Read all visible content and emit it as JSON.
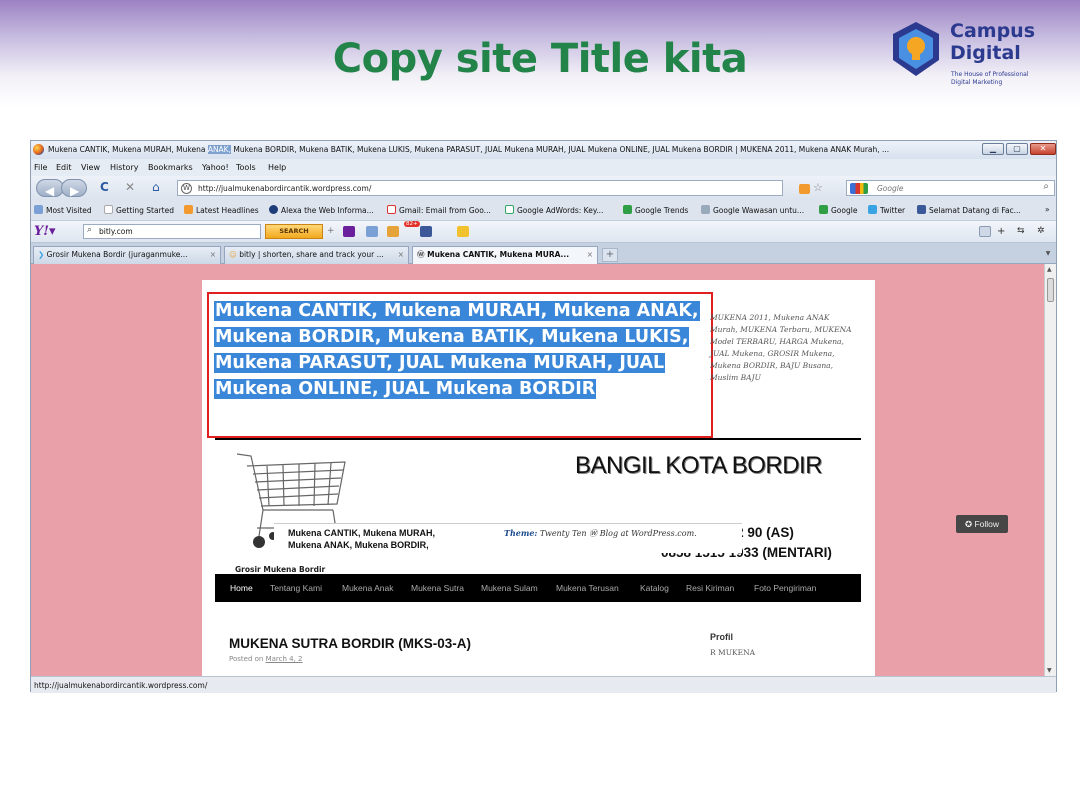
{
  "slide": {
    "title": "Copy site Title kita",
    "logo": {
      "line1": "Campus",
      "line2": "Digital",
      "tagline1": "The House of Professional",
      "tagline2": "Digital Marketing",
      "icon": "lightbulb-shield-icon",
      "brand_color": "#2b3a8f",
      "accent_color": "#f5a623"
    }
  },
  "browser": {
    "window_title": "Mukena CANTIK, Mukena MURAH, Mukena ANAK, Mukena BORDIR, Mukena BATIK, Mukena LUKIS, Mukena PARASUT, JUAL Mukena MURAH, JUAL Mukena ONLINE, JUAL Mukena BORDIR | MUKENA 2011, Mukena ANAK Murah, ...",
    "window_title_pre": "Mukena CANTIK, Mukena MURAH, Mukena ",
    "window_title_hl": "ANAK,",
    "window_title_post": " Mukena BORDIR, Mukena BATIK, Mukena LUKIS, Mukena PARASUT, JUAL Mukena MURAH, JUAL Mukena ONLINE, JUAL Mukena BORDIR | MUKENA 2011, Mukena ANAK Murah, ...",
    "menu": [
      "File",
      "Edit",
      "View",
      "History",
      "Bookmarks",
      "Yahoo!",
      "Tools",
      "Help"
    ],
    "url": "http://jualmukenabordircantik.wordpress.com/",
    "search_placeholder": "Google",
    "bookmarks": [
      "Most Visited",
      "Getting Started",
      "Latest Headlines",
      "Alexa the Web Informa...",
      "Gmail: Email from Goo...",
      "Google AdWords: Key...",
      "Google Trends",
      "Google Wawasan untu...",
      "Google",
      "Twitter",
      "Selamat Datang di Fac..."
    ],
    "yahoo_search_value": "bitly.com",
    "yahoo_search_button": "SEARCH",
    "mail_badge": "82+",
    "tabs": [
      {
        "label": "Grosir Mukena Bordir (juraganmuke...",
        "active": false
      },
      {
        "label": "bitly | shorten, share and track your ...",
        "active": false
      },
      {
        "label": "Mukena CANTIK, Mukena MURA...",
        "active": true
      }
    ],
    "status_url": "http://jualmukenabordircantik.wordpress.com/"
  },
  "site": {
    "title": "Mukena CANTIK, Mukena MURAH, Mukena ANAK, Mukena BORDIR, Mukena BATIK, Mukena LUKIS, Mukena PARASUT, JUAL Mukena MURAH, JUAL Mukena ONLINE, JUAL Mukena BORDIR",
    "description_lines": [
      "MUKENA 2011, Mukena ANAK",
      "Murah, MUKENA Terbaru, MUKENA",
      "Model TERBARU, HARGA Mukena,",
      "JUAL Mukena, GROSIR Mukena,",
      "Mukena BORDIR, BAJU Busana,",
      "Muslim BAJU"
    ],
    "banner_title": "BANGIL KOTA BORDIR",
    "phone1": "0852 59 3322 90 (AS)",
    "phone2": "0858 1515 1933  (MENTARI)",
    "cart_caption": "Grosir Mukena Bordir",
    "nav": [
      "Home",
      "Tentang Kami",
      "Mukena Anak",
      "Mukena Sutra",
      "Mukena Sulam",
      "Mukena Terusan",
      "Katalog",
      "Resi Kiriman",
      "Foto Pengiriman"
    ],
    "post_title": "MUKENA SUTRA BORDIR (MKS-03-A)",
    "post_meta_prefix": "Posted on",
    "post_meta_date": "March 4, 2",
    "sidebar_heading": "Profil",
    "sidebar_faint": "R MUKENA",
    "popup_line1": "Mukena CANTIK, Mukena MURAH,",
    "popup_line2": "Mukena ANAK, Mukena BORDIR,",
    "theme_text": "Theme:",
    "theme_rest": "Twenty Ten",
    "blog_at": "Blog at WordPress.com.",
    "follow_label": "Follow"
  },
  "colors": {
    "title_green": "#23844a",
    "selection_blue": "#3a86d8",
    "highlight_red": "#e01f1f",
    "page_bg": "#e9a0a8"
  }
}
